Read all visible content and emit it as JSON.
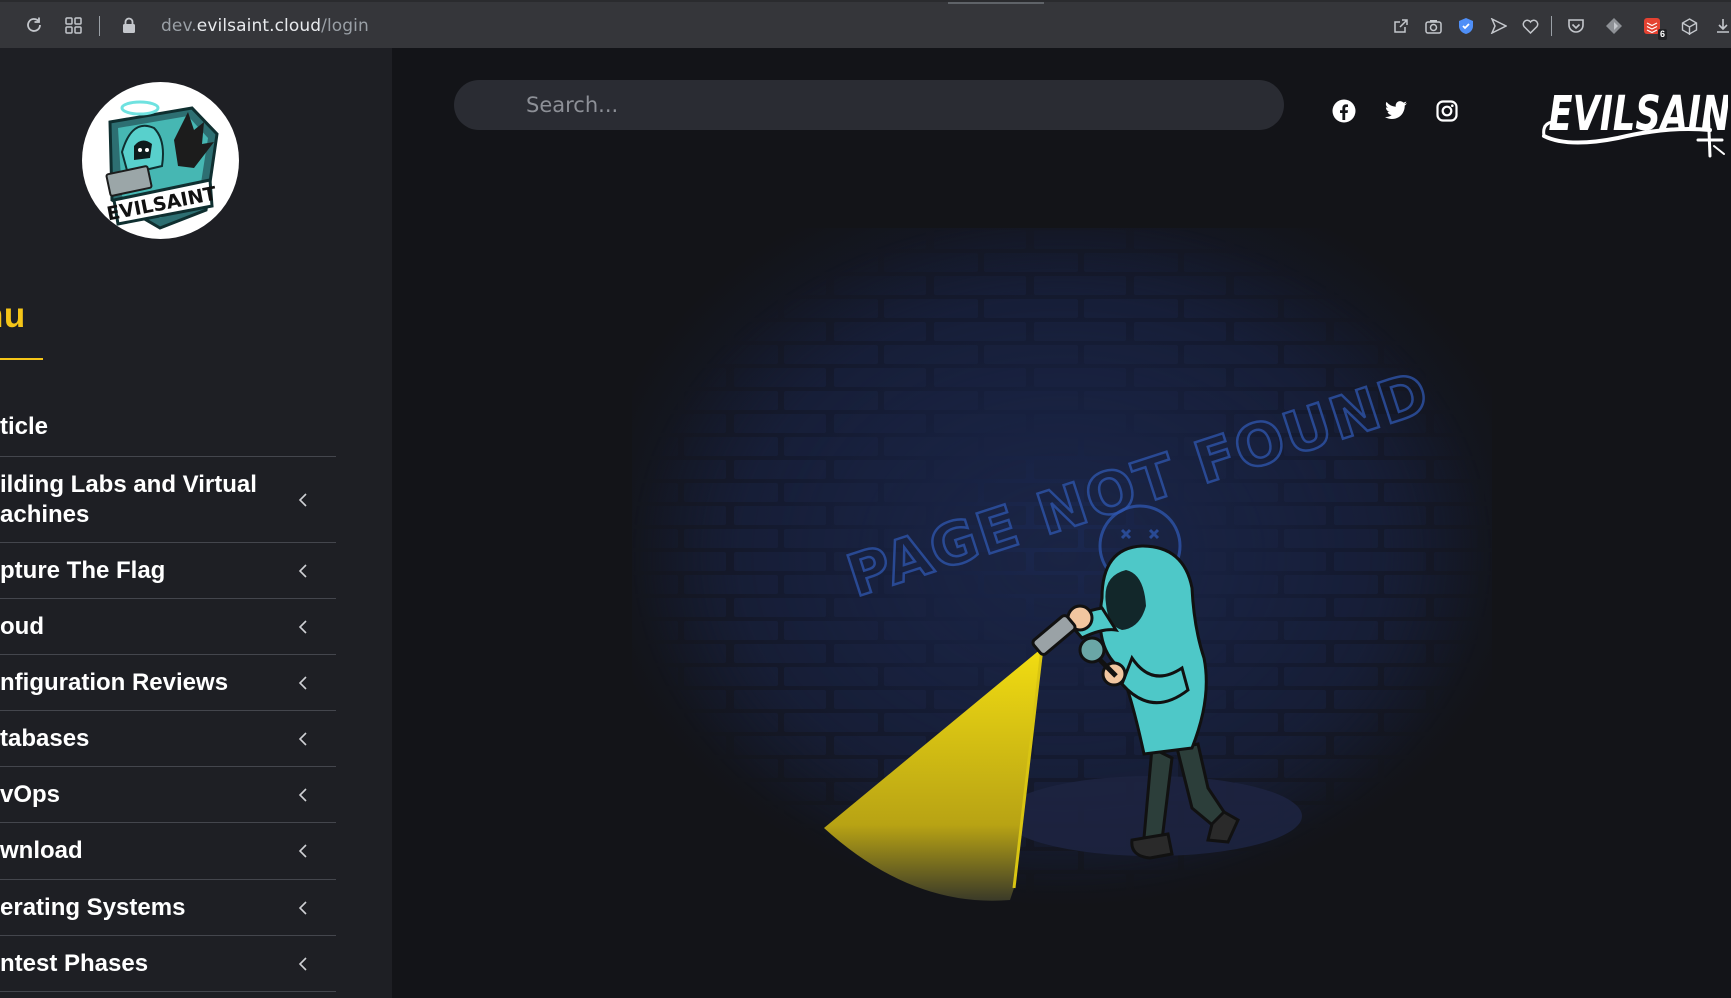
{
  "browser": {
    "url_prefix": "dev.",
    "url_domain": "evilsaint.cloud",
    "url_path": "/login",
    "extension_badge": "6"
  },
  "sidebar": {
    "logo_text": "EVILSAINT",
    "menu_title": "Menu",
    "menu_title_visible": "enu",
    "items": [
      {
        "label": "ticle",
        "has_submenu": false
      },
      {
        "label": "ilding Labs and Virtual",
        "label2": "achines",
        "has_submenu": true
      },
      {
        "label": "pture The Flag",
        "has_submenu": true
      },
      {
        "label": "oud",
        "has_submenu": true
      },
      {
        "label": "nfiguration Reviews",
        "has_submenu": true
      },
      {
        "label": "tabases",
        "has_submenu": true
      },
      {
        "label": "vOps",
        "has_submenu": true
      },
      {
        "label": "wnload",
        "has_submenu": true
      },
      {
        "label": "erating Systems",
        "has_submenu": true
      },
      {
        "label": "ntest Phases",
        "has_submenu": true
      }
    ]
  },
  "header": {
    "search_placeholder": "Search...",
    "social": [
      "facebook-icon",
      "twitter-icon",
      "instagram-icon"
    ],
    "brand": "EVILSAINT"
  },
  "content": {
    "illustration_text": "PAGE NOT FOUND"
  },
  "colors": {
    "accent": "#f5c518",
    "sidebar_bg": "#1e1f24",
    "main_bg": "#131418",
    "hoodie": "#4ec8c8"
  }
}
